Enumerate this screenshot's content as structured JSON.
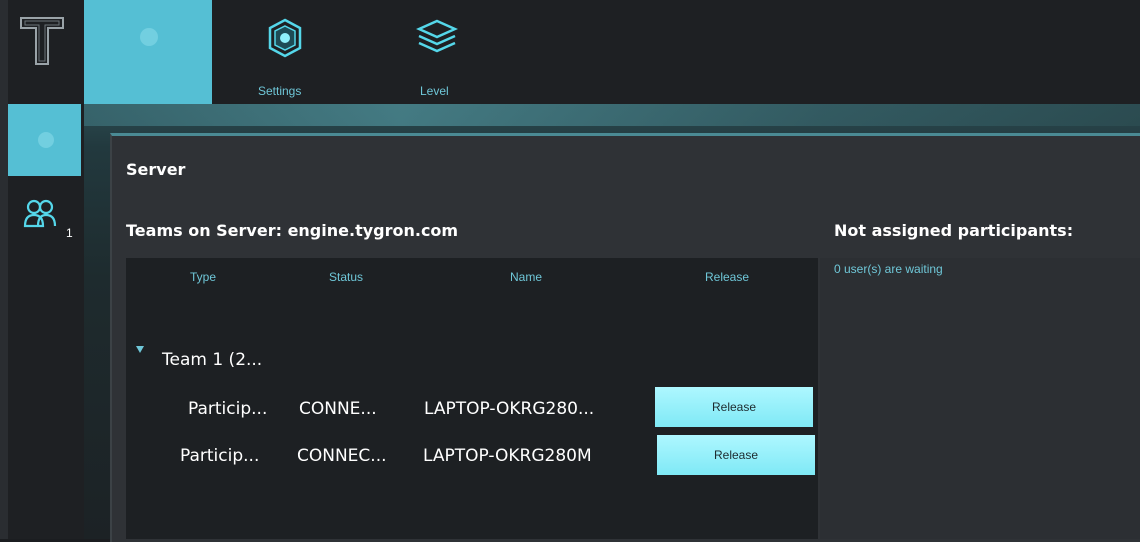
{
  "topbar": {
    "settings_label": "Settings",
    "level_label": "Level"
  },
  "sidebar": {
    "users_badge": "1"
  },
  "panel": {
    "title": "Server",
    "teams_label": "Teams on Server: engine.tygron.com",
    "not_assigned_label": "Not assigned participants:",
    "waiting_text": "0 user(s) are waiting"
  },
  "table": {
    "headers": [
      "Type",
      "Status",
      "Name",
      "Release"
    ],
    "team_label": "Team 1 (2...",
    "rows": [
      {
        "type": "Particip...",
        "status": "CONNE...",
        "name": "LAPTOP-OKRG280...",
        "release": "Release"
      },
      {
        "type": "Particip...",
        "status": "CONNEC...",
        "name": "LAPTOP-OKRG280M",
        "release": "Release"
      }
    ]
  },
  "colors": {
    "accent": "#55bfd4",
    "label_cyan": "#6fc7d8",
    "button": "#8ff0fb"
  },
  "icons": [
    "tygron-logo-icon",
    "settings-hexagon-icon",
    "level-layers-icon",
    "users-icon"
  ]
}
